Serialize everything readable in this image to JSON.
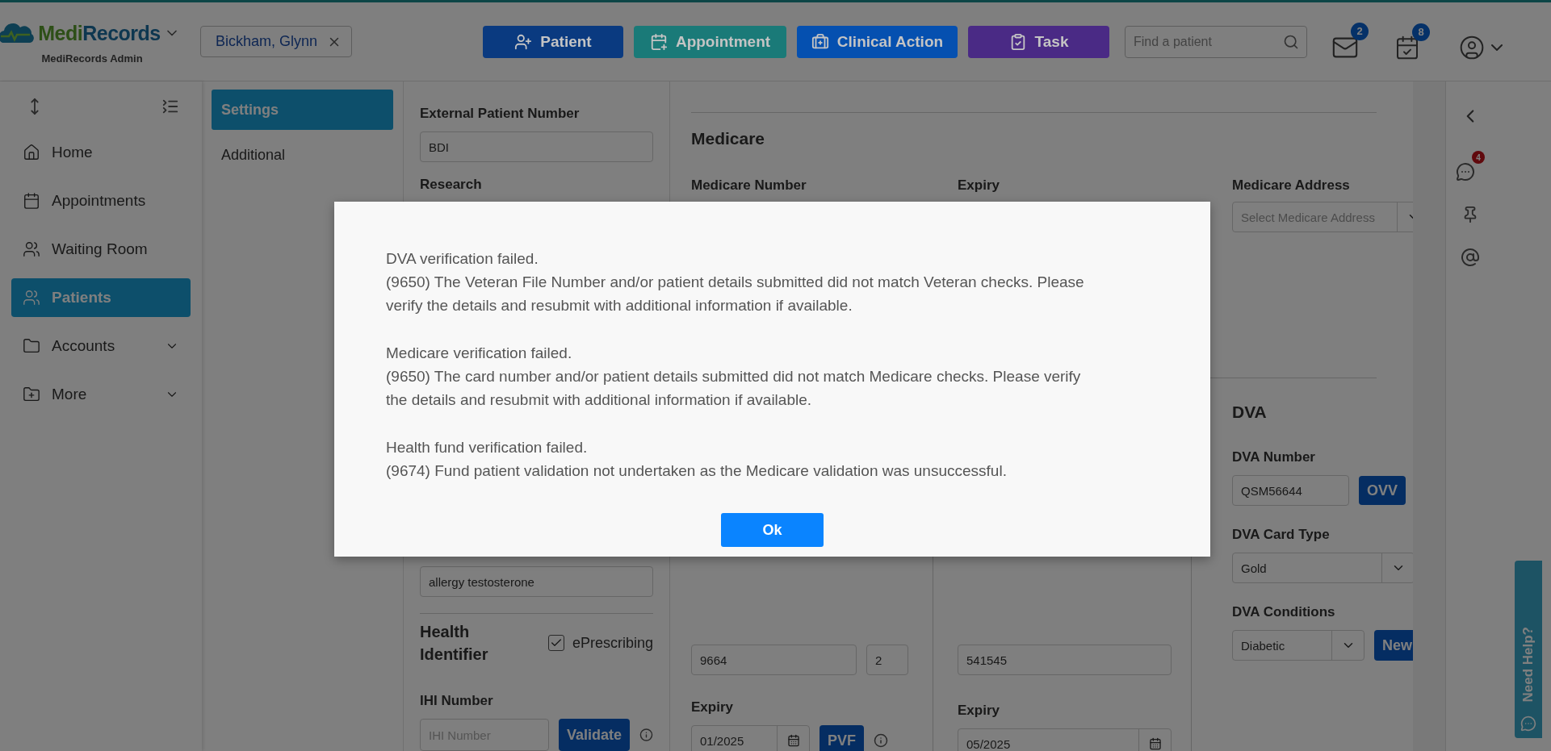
{
  "header": {
    "logo": {
      "part_1": "Medi",
      "part_2": "Records"
    },
    "account": "MediRecords Admin",
    "patient_tab": "Bickham, Glynn",
    "actions": [
      {
        "label": "Patient",
        "color": "#0a3a80"
      },
      {
        "label": "Appointment",
        "color": "#1a7a78"
      },
      {
        "label": "Clinical Action",
        "color": "#0550b0"
      },
      {
        "label": "Task",
        "color": "#4a2a85"
      }
    ],
    "search": {
      "placeholder": "Find a patient"
    },
    "messages_badge": "2",
    "tasks_badge": "8"
  },
  "sidebar": {
    "items": [
      {
        "label": "Home",
        "selected": false,
        "has_submenu": false
      },
      {
        "label": "Appointments",
        "selected": false,
        "has_submenu": false
      },
      {
        "label": "Waiting Room",
        "selected": false,
        "has_submenu": false
      },
      {
        "label": "Patients",
        "selected": true,
        "has_submenu": false
      },
      {
        "label": "Accounts",
        "selected": false,
        "has_submenu": true
      },
      {
        "label": "More",
        "selected": false,
        "has_submenu": true
      }
    ]
  },
  "subnav": {
    "items": [
      {
        "label": "Settings",
        "selected": true
      },
      {
        "label": "Additional",
        "selected": false
      }
    ]
  },
  "form": {
    "external_patient_number": {
      "label": "External Patient Number",
      "value": "BDI"
    },
    "research": {
      "label": "Research"
    },
    "allergy": {
      "value": "allergy testosterone"
    },
    "health_identifier": {
      "title": "Health Identifier",
      "eprescribing": {
        "label": "ePrescribing",
        "checked": true
      }
    },
    "ihi": {
      "label": "IHI Number",
      "placeholder": "IHI Number",
      "button": "Validate"
    },
    "medicare": {
      "heading": "Medicare",
      "number_label": "Medicare Number",
      "expiry_label": "Expiry",
      "address_label": "Medicare Address",
      "address_placeholder": "Select Medicare Address",
      "number": "9664",
      "irn": "2",
      "card_expiry_label": "Expiry",
      "card_expiry": "01/2025",
      "button": "PVF"
    },
    "column_2": {
      "value": "541545",
      "expiry_label": "Expiry",
      "expiry": "05/2025"
    },
    "dva": {
      "heading": "DVA",
      "number_label": "DVA Number",
      "number": "QSM56644",
      "button": "OVV",
      "card_type_label": "DVA Card Type",
      "card_type": "Gold",
      "conditions_label": "DVA Conditions",
      "conditions": "Diabetic",
      "new_button": "New"
    }
  },
  "right_rail": {
    "chat_badge": "4",
    "help_tab": "Need Help?"
  },
  "dialog": {
    "paragraphs": [
      {
        "title": "DVA verification failed.",
        "detail": "(9650) The Veteran File Number and/or patient details submitted did not match Veteran checks. Please verify the details and resubmit with additional information if available."
      },
      {
        "title": "Medicare verification failed.",
        "detail": "(9650) The card number and/or patient details submitted did not match Medicare checks. Please verify the details and resubmit with additional information if available."
      },
      {
        "title": "Health fund verification failed.",
        "detail": "(9674) Fund patient validation not undertaken as the Medicare validation was unsuccessful."
      }
    ],
    "button": "Ok"
  }
}
